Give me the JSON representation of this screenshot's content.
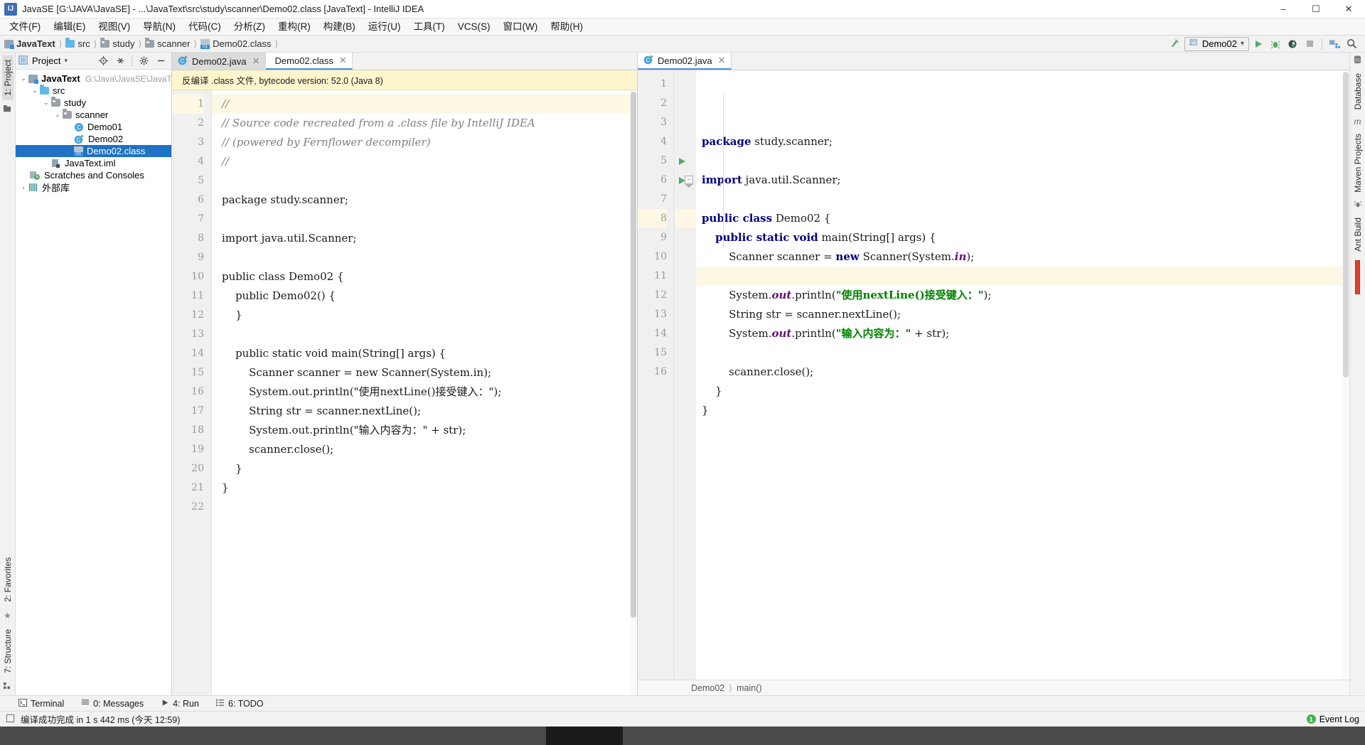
{
  "window": {
    "title": "JavaSE [G:\\JAVA\\JavaSE] - ...\\JavaText\\src\\study\\scanner\\Demo02.class [JavaText] - IntelliJ IDEA",
    "app_icon_text": "IJ",
    "controls": {
      "minimize": "–",
      "maximize": "☐",
      "close": "✕"
    }
  },
  "menubar": [
    "文件(F)",
    "编辑(E)",
    "视图(V)",
    "导航(N)",
    "代码(C)",
    "分析(Z)",
    "重构(R)",
    "构建(B)",
    "运行(U)",
    "工具(T)",
    "VCS(S)",
    "窗口(W)",
    "帮助(H)"
  ],
  "breadcrumb": [
    {
      "label": "JavaText",
      "icon": "module-icon",
      "bold": true
    },
    {
      "label": "src",
      "icon": "source-folder-icon",
      "bold": false
    },
    {
      "label": "study",
      "icon": "package-folder-icon",
      "bold": false
    },
    {
      "label": "scanner",
      "icon": "package-folder-icon",
      "bold": false
    },
    {
      "label": "Demo02.class",
      "icon": "class-file-icon",
      "bold": false
    }
  ],
  "toolbar": {
    "run_config": "Demo02",
    "icons": [
      "build-hammer-icon",
      "run-config-icon",
      "run-icon",
      "debug-icon",
      "run-with-coverage-icon",
      "stop-icon",
      "project-structure-icon",
      "search-everywhere-icon"
    ]
  },
  "rails": {
    "left_top": "1: Project",
    "left_bottom": [
      "2: Favorites",
      "7: Structure"
    ],
    "right": [
      "Database",
      "Maven Projects",
      "Ant Build"
    ]
  },
  "project_panel": {
    "title": "Project",
    "tools": [
      "locate-icon",
      "collapse-all-icon",
      "settings-gear-icon",
      "hide-icon"
    ],
    "tree": [
      {
        "depth": 0,
        "twist": "⌄",
        "icon": "module-icon",
        "label": "JavaText",
        "bold": true,
        "path": "G:\\Java\\JavaSE\\JavaText",
        "selected": false
      },
      {
        "depth": 1,
        "twist": "⌄",
        "icon": "source-folder-icon",
        "label": "src",
        "bold": false,
        "path": "",
        "selected": false
      },
      {
        "depth": 2,
        "twist": "⌄",
        "icon": "package-folder-icon",
        "label": "study",
        "bold": false,
        "path": "",
        "selected": false
      },
      {
        "depth": 3,
        "twist": "⌄",
        "icon": "package-folder-icon",
        "label": "scanner",
        "bold": false,
        "path": "",
        "selected": false
      },
      {
        "depth": 4,
        "twist": "",
        "icon": "java-class-icon",
        "label": "Demo01",
        "bold": false,
        "path": "",
        "selected": false
      },
      {
        "depth": 4,
        "twist": "",
        "icon": "java-runnable-class-icon",
        "label": "Demo02",
        "bold": false,
        "path": "",
        "selected": false
      },
      {
        "depth": 4,
        "twist": "",
        "icon": "class-file-icon",
        "label": "Demo02.class",
        "bold": false,
        "path": "",
        "selected": true
      },
      {
        "depth": 1,
        "twist": "",
        "icon": "iml-file-icon",
        "label": "JavaText.iml",
        "bold": false,
        "path": "",
        "selected": false
      },
      {
        "depth": 0,
        "twist": "",
        "icon": "scratches-icon",
        "label": "Scratches and Consoles",
        "bold": false,
        "path": "",
        "selected": false
      },
      {
        "depth": 0,
        "twist": "›",
        "icon": "external-libraries-icon",
        "label": "外部库",
        "bold": false,
        "path": "",
        "selected": false
      }
    ]
  },
  "left_editor": {
    "tabs": [
      {
        "label": "Demo02.java",
        "icon": "java-runnable-class-icon",
        "active": false
      },
      {
        "label": "Demo02.class",
        "icon": "class-file-icon",
        "active": true
      }
    ],
    "banner": "反编译 .class 文件, bytecode version: 52.0 (Java 8)",
    "first_line": 1,
    "lines": [
      {
        "n": 1,
        "hl": true,
        "tokens": [
          {
            "t": "//",
            "c": "cmt"
          }
        ]
      },
      {
        "n": 2,
        "hl": false,
        "tokens": [
          {
            "t": "// Source code recreated from a .class file by IntelliJ IDEA",
            "c": "cmt"
          }
        ]
      },
      {
        "n": 3,
        "hl": false,
        "tokens": [
          {
            "t": "// (powered by Fernflower decompiler)",
            "c": "cmt"
          }
        ]
      },
      {
        "n": 4,
        "hl": false,
        "tokens": [
          {
            "t": "//",
            "c": "cmt"
          }
        ]
      },
      {
        "n": 5,
        "hl": false,
        "tokens": []
      },
      {
        "n": 6,
        "hl": false,
        "tokens": [
          {
            "t": "package study.scanner;",
            "c": ""
          }
        ]
      },
      {
        "n": 7,
        "hl": false,
        "tokens": []
      },
      {
        "n": 8,
        "hl": false,
        "tokens": [
          {
            "t": "import java.util.Scanner;",
            "c": ""
          }
        ]
      },
      {
        "n": 9,
        "hl": false,
        "tokens": []
      },
      {
        "n": 10,
        "hl": false,
        "tokens": [
          {
            "t": "public class Demo02 {",
            "c": ""
          }
        ]
      },
      {
        "n": 11,
        "hl": false,
        "tokens": [
          {
            "t": "    public Demo02() {",
            "c": ""
          }
        ]
      },
      {
        "n": 12,
        "hl": false,
        "tokens": [
          {
            "t": "    }",
            "c": ""
          }
        ]
      },
      {
        "n": 13,
        "hl": false,
        "tokens": []
      },
      {
        "n": 14,
        "hl": false,
        "tokens": [
          {
            "t": "    public static void main(String[] args) {",
            "c": ""
          }
        ]
      },
      {
        "n": 15,
        "hl": false,
        "tokens": [
          {
            "t": "        Scanner scanner = new Scanner(System.in);",
            "c": ""
          }
        ]
      },
      {
        "n": 16,
        "hl": false,
        "tokens": [
          {
            "t": "        System.out.println(\"使用nextLine()接受键入：\");",
            "c": ""
          }
        ]
      },
      {
        "n": 17,
        "hl": false,
        "tokens": [
          {
            "t": "        String str = scanner.nextLine();",
            "c": ""
          }
        ]
      },
      {
        "n": 18,
        "hl": false,
        "tokens": [
          {
            "t": "        System.out.println(\"输入内容为：\" + str);",
            "c": ""
          }
        ]
      },
      {
        "n": 19,
        "hl": false,
        "tokens": [
          {
            "t": "        scanner.close();",
            "c": ""
          }
        ]
      },
      {
        "n": 20,
        "hl": false,
        "tokens": [
          {
            "t": "    }",
            "c": ""
          }
        ]
      },
      {
        "n": 21,
        "hl": false,
        "tokens": [
          {
            "t": "}",
            "c": ""
          }
        ]
      },
      {
        "n": 22,
        "hl": false,
        "tokens": []
      }
    ]
  },
  "right_editor": {
    "tabs": [
      {
        "label": "Demo02.java",
        "icon": "java-runnable-class-icon",
        "active": true
      }
    ],
    "lines": [
      {
        "n": 1,
        "hl": false,
        "run": false,
        "fold": false,
        "tokens": [
          {
            "t": "package",
            "c": "kw"
          },
          {
            "t": " study.scanner;",
            "c": ""
          }
        ]
      },
      {
        "n": 2,
        "hl": false,
        "run": false,
        "fold": false,
        "tokens": []
      },
      {
        "n": 3,
        "hl": false,
        "run": false,
        "fold": false,
        "tokens": [
          {
            "t": "import",
            "c": "kw"
          },
          {
            "t": " java.util.Scanner;",
            "c": ""
          }
        ]
      },
      {
        "n": 4,
        "hl": false,
        "run": false,
        "fold": false,
        "tokens": []
      },
      {
        "n": 5,
        "hl": false,
        "run": true,
        "fold": false,
        "tokens": [
          {
            "t": "public class",
            "c": "kw"
          },
          {
            "t": " Demo02 {",
            "c": ""
          }
        ]
      },
      {
        "n": 6,
        "hl": false,
        "run": true,
        "fold": true,
        "tokens": [
          {
            "t": "    ",
            "c": ""
          },
          {
            "t": "public static void",
            "c": "kw"
          },
          {
            "t": " main(String[] args) {",
            "c": ""
          }
        ]
      },
      {
        "n": 7,
        "hl": false,
        "run": false,
        "fold": false,
        "tokens": [
          {
            "t": "        Scanner scanner = ",
            "c": ""
          },
          {
            "t": "new",
            "c": "kw"
          },
          {
            "t": " Scanner(System.",
            "c": ""
          },
          {
            "t": "in",
            "c": "fld"
          },
          {
            "t": ");",
            "c": ""
          }
        ]
      },
      {
        "n": 8,
        "hl": true,
        "run": false,
        "fold": false,
        "tokens": []
      },
      {
        "n": 9,
        "hl": false,
        "run": false,
        "fold": false,
        "tokens": [
          {
            "t": "        System.",
            "c": ""
          },
          {
            "t": "out",
            "c": "fld"
          },
          {
            "t": ".println(",
            "c": ""
          },
          {
            "t": "\"使用nextLine()接受键入：\"",
            "c": "str"
          },
          {
            "t": ");",
            "c": ""
          }
        ]
      },
      {
        "n": 10,
        "hl": false,
        "run": false,
        "fold": false,
        "tokens": [
          {
            "t": "        String str = scanner.nextLine();",
            "c": ""
          }
        ]
      },
      {
        "n": 11,
        "hl": false,
        "run": false,
        "fold": false,
        "tokens": [
          {
            "t": "        System.",
            "c": ""
          },
          {
            "t": "out",
            "c": "fld"
          },
          {
            "t": ".println(",
            "c": ""
          },
          {
            "t": "\"输入内容为：\"",
            "c": "str"
          },
          {
            "t": " + str);",
            "c": ""
          }
        ]
      },
      {
        "n": 12,
        "hl": false,
        "run": false,
        "fold": false,
        "tokens": []
      },
      {
        "n": 13,
        "hl": false,
        "run": false,
        "fold": false,
        "tokens": [
          {
            "t": "        scanner.close();",
            "c": ""
          }
        ]
      },
      {
        "n": 14,
        "hl": false,
        "run": false,
        "fold": false,
        "tokens": [
          {
            "t": "    }",
            "c": ""
          }
        ]
      },
      {
        "n": 15,
        "hl": false,
        "run": false,
        "fold": false,
        "tokens": [
          {
            "t": "}",
            "c": ""
          }
        ]
      },
      {
        "n": 16,
        "hl": false,
        "run": false,
        "fold": false,
        "tokens": []
      }
    ],
    "breadcrumb": [
      "Demo02",
      "main()"
    ]
  },
  "toolwindows": [
    {
      "label": "Terminal",
      "icon": "terminal-icon",
      "key": ""
    },
    {
      "label": "0: Messages",
      "icon": "messages-icon",
      "key": "0"
    },
    {
      "label": "4: Run",
      "icon": "run-icon",
      "key": "4"
    },
    {
      "label": "6: TODO",
      "icon": "todo-icon",
      "key": "6"
    }
  ],
  "statusbar": {
    "message": "编译成功完成 in 1 s 442 ms (今天 12:59)",
    "event_log": "Event Log",
    "event_count": "1"
  },
  "colors": {
    "accent": "#1f72c4",
    "keyword": "#000080",
    "string": "#008000",
    "field": "#660e7a",
    "comment": "#808080",
    "caret_line": "#fdf8e3",
    "banner": "#fdf6cd",
    "run_green": "#59a869"
  }
}
